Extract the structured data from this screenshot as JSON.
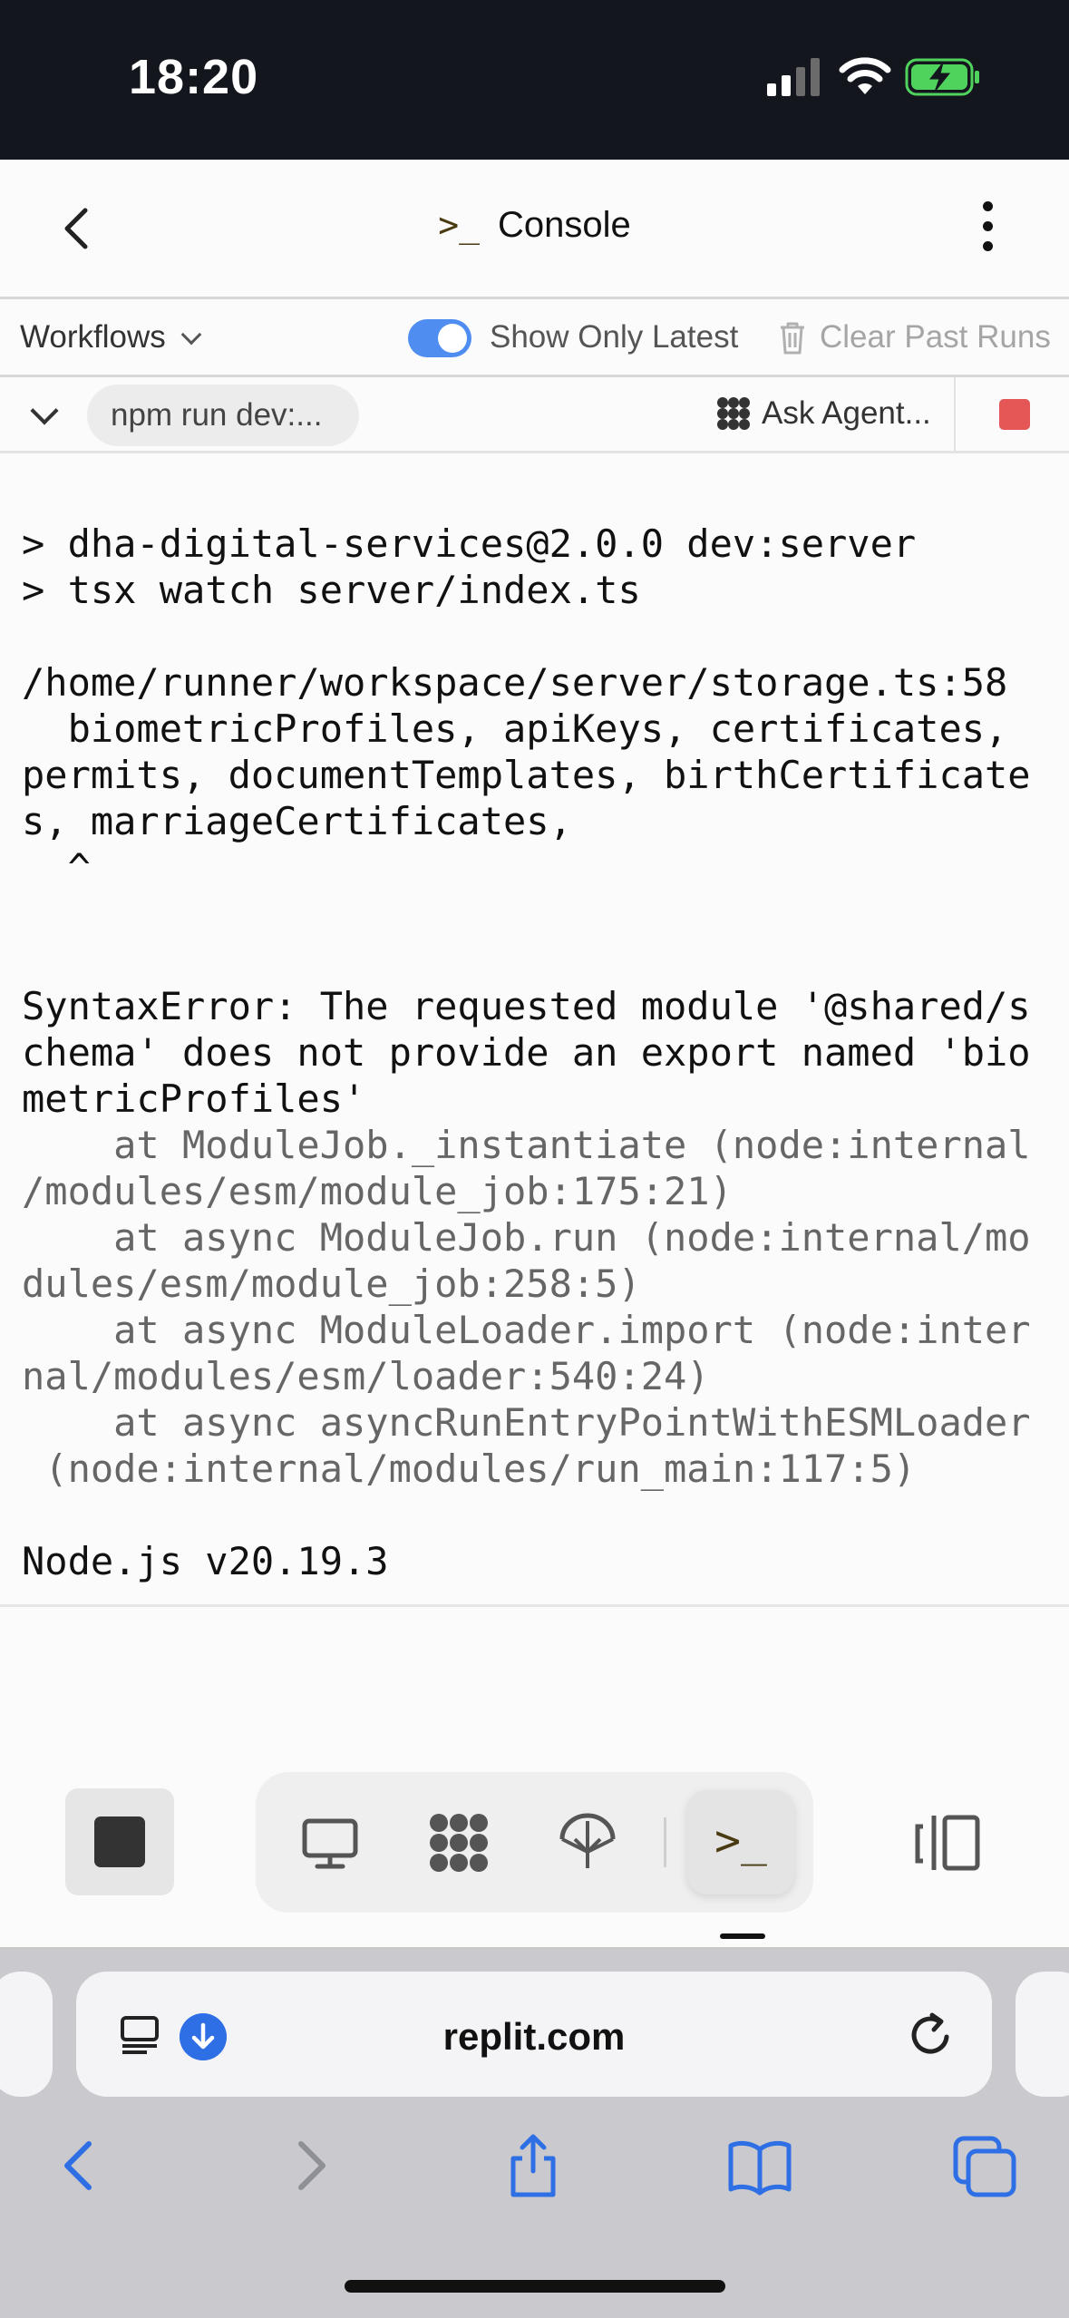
{
  "status_bar": {
    "time": "18:20"
  },
  "header": {
    "title_icon": ">_",
    "title": "Console"
  },
  "workflow_bar": {
    "workflows_label": "Workflows",
    "toggle_label": "Show Only Latest",
    "toggle_on": true,
    "clear_label": "Clear Past Runs"
  },
  "run_bar": {
    "command": "npm run dev:...",
    "ask_agent_label": "Ask Agent..."
  },
  "console": {
    "lines": [
      {
        "text": "> dha-digital-services@2.0.0 dev:server",
        "dim": false
      },
      {
        "text": "> tsx watch server/index.ts",
        "dim": false
      },
      {
        "text": "",
        "dim": false
      },
      {
        "text": "/home/runner/workspace/server/storage.ts:58",
        "dim": false
      },
      {
        "text": "  biometricProfiles, apiKeys, certificates,",
        "dim": false
      },
      {
        "text": "permits, documentTemplates, birthCertificate",
        "dim": false
      },
      {
        "text": "s, marriageCertificates,",
        "dim": false
      },
      {
        "text": "  ^",
        "dim": false
      },
      {
        "text": "",
        "dim": false
      },
      {
        "text": "",
        "dim": false
      },
      {
        "text": "SyntaxError: The requested module '@shared/s",
        "dim": false
      },
      {
        "text": "chema' does not provide an export named 'bio",
        "dim": false
      },
      {
        "text": "metricProfiles'",
        "dim": false
      },
      {
        "text": "    at ModuleJob._instantiate (node:internal",
        "dim": true
      },
      {
        "text": "/modules/esm/module_job:175:21)",
        "dim": true
      },
      {
        "text": "    at async ModuleJob.run (node:internal/mo",
        "dim": true
      },
      {
        "text": "dules/esm/module_job:258:5)",
        "dim": true
      },
      {
        "text": "    at async ModuleLoader.import (node:inter",
        "dim": true
      },
      {
        "text": "nal/modules/esm/loader:540:24)",
        "dim": true
      },
      {
        "text": "    at async asyncRunEntryPointWithESMLoader",
        "dim": true
      },
      {
        "text": " (node:internal/modules/run_main:117:5)",
        "dim": true
      },
      {
        "text": "",
        "dim": false
      },
      {
        "text": "Node.js v20.19.3",
        "dim": false
      }
    ]
  },
  "dock": {
    "active_tab_glyph": ">_",
    "tabs": [
      "webview-tab",
      "agent-tab",
      "deployments-tab",
      "console-tab"
    ]
  },
  "safari": {
    "url": "replit.com"
  },
  "colors": {
    "status_bar_bg": "#14161d",
    "toggle_on": "#4f8ef0",
    "stop_red": "#e55656",
    "safari_blue": "#2f6fe6",
    "console_prompt": "#4a3a12"
  }
}
